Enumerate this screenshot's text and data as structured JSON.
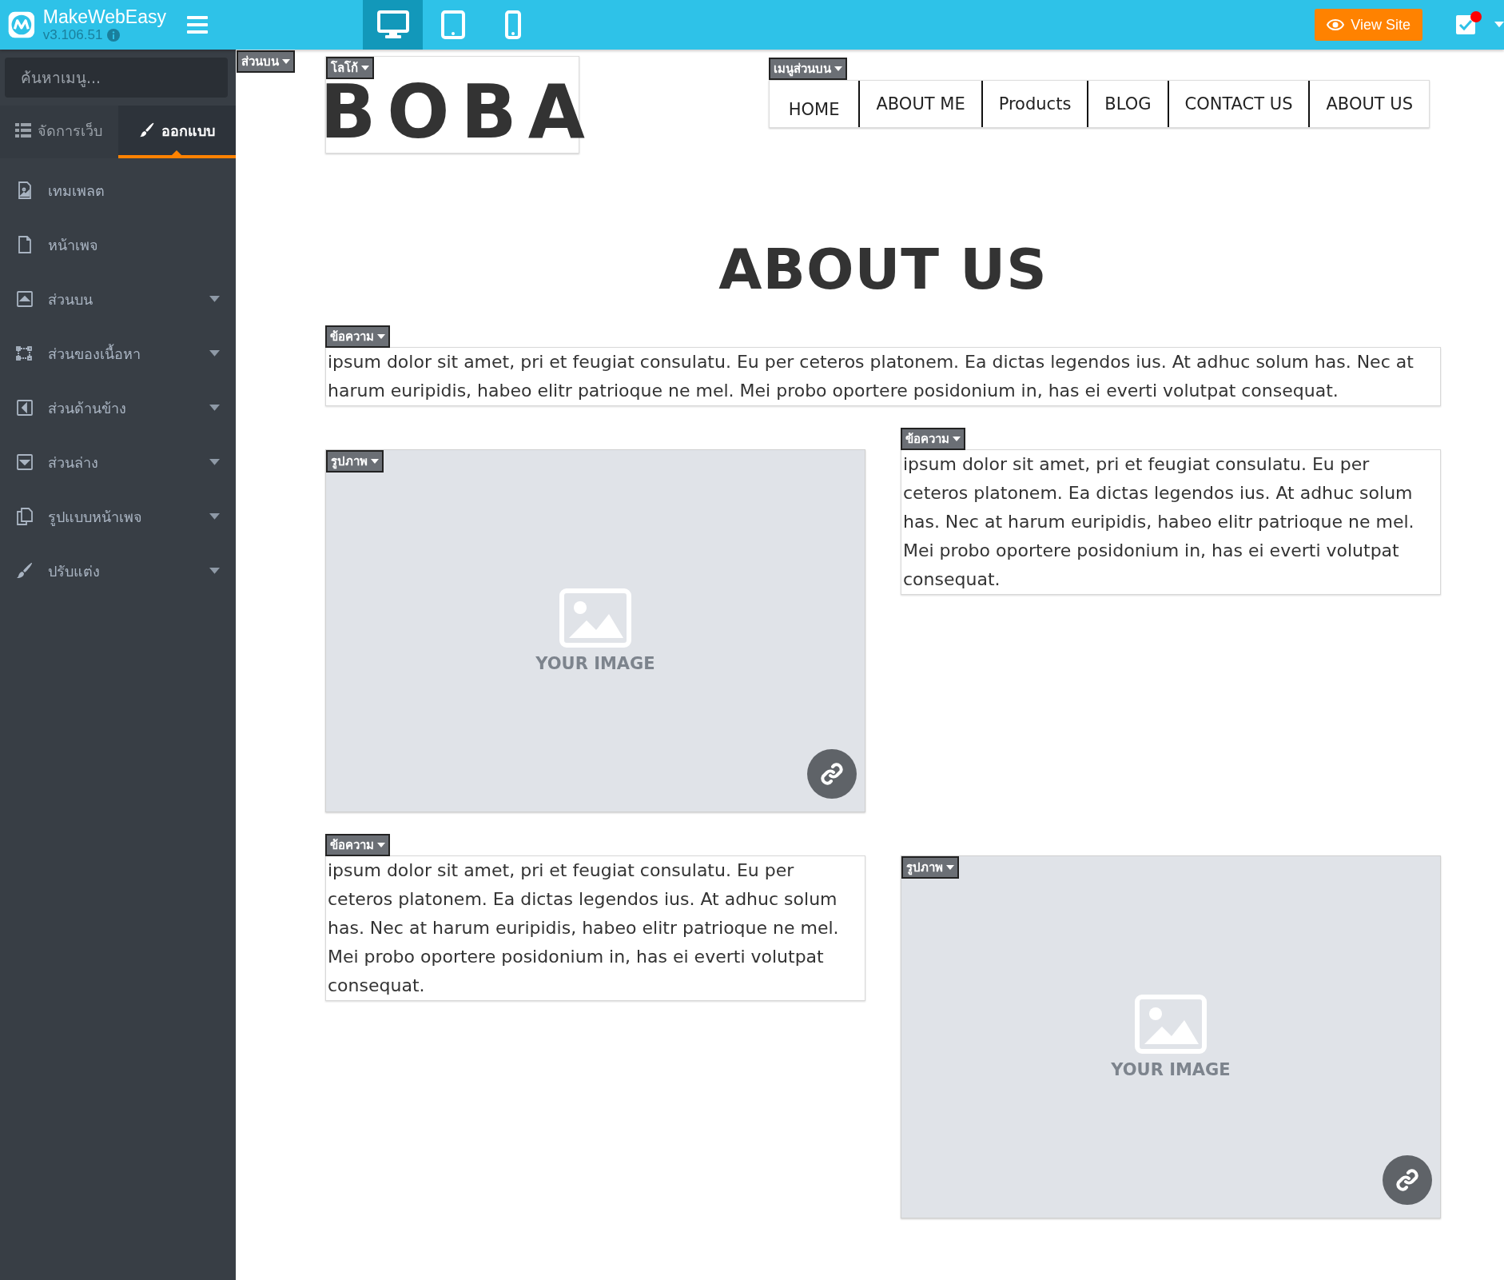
{
  "app": {
    "name": "MakeWebEasy",
    "version": "v3.106.51"
  },
  "devices": [
    {
      "selected": true
    },
    {
      "selected": false
    },
    {
      "selected": false
    }
  ],
  "view_site": "View Site",
  "notifications": {
    "unread": true
  },
  "sidebar": {
    "search": {
      "placeholder": "ค้นหาเมนู..."
    },
    "tabs": [
      {
        "label": "จัดการเว็บ",
        "selected": false
      },
      {
        "label": "ออกแบบ",
        "selected": true
      }
    ],
    "items": [
      {
        "label": "เทมเพลต",
        "expandable": false
      },
      {
        "label": "หน้าเพจ",
        "expandable": false
      },
      {
        "label": "ส่วนบน",
        "expandable": true
      },
      {
        "label": "ส่วนของเนื้อหา",
        "expandable": true
      },
      {
        "label": "ส่วนด้านข้าง",
        "expandable": true
      },
      {
        "label": "ส่วนล่าง",
        "expandable": true
      },
      {
        "label": "รูปแบบหน้าเพจ",
        "expandable": true
      },
      {
        "label": "ปรับแต่ง",
        "expandable": true
      }
    ]
  },
  "canvas": {
    "section_tag": "ส่วนบน",
    "logo": {
      "tag": "โลโก้",
      "text": "BOBA"
    },
    "menu": {
      "tag": "เมนูส่วนบน",
      "items": [
        "HOME",
        "ABOUT ME",
        "Products",
        "BLOG",
        "CONTACT US",
        "ABOUT US"
      ]
    },
    "title": "ABOUT US",
    "rows": [
      [
        {
          "kind": "text",
          "tag": "ข้อความ",
          "text": "ipsum dolor sit amet, pri et feugiat consulatu. Eu per ceteros platonem. Ea dictas legendos ius. At adhuc solum has. Nec at harum euripidis, habeo elitr patrioque ne mel. Mei probo oportere posidonium in, has ei everti volutpat consequat."
        }
      ],
      [
        {
          "kind": "image",
          "tag": "รูปภาพ",
          "caption": "YOUR IMAGE"
        },
        {
          "kind": "text",
          "tag": "ข้อความ",
          "text": "ipsum dolor sit amet, pri et feugiat consulatu. Eu per ceteros platonem. Ea dictas legendos ius. At adhuc solum has. Nec at harum euripidis, habeo elitr patrioque ne mel. Mei probo oportere posidonium in, has ei everti volutpat consequat."
        }
      ],
      [
        {
          "kind": "text",
          "tag": "ข้อความ",
          "text": "ipsum dolor sit amet, pri et feugiat consulatu. Eu per ceteros platonem. Ea dictas legendos ius. At adhuc solum has. Nec at harum euripidis, habeo elitr patrioque ne mel. Mei probo oportere posidonium in, has ei everti volutpat consequat."
        },
        {
          "kind": "image",
          "tag": "รูปภาพ",
          "caption": "YOUR IMAGE"
        }
      ]
    ]
  }
}
